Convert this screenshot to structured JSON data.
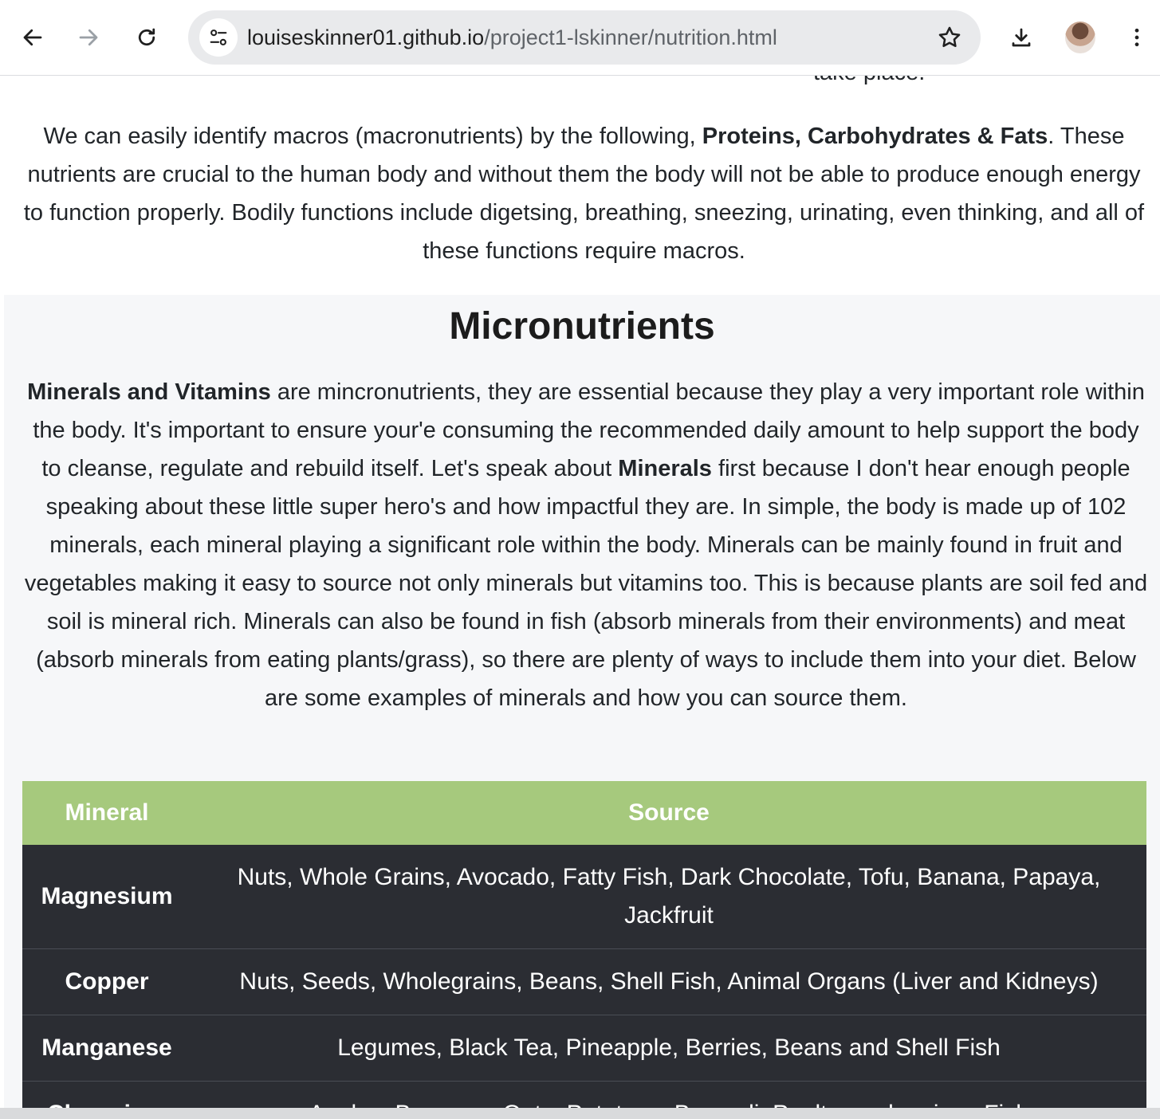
{
  "browser": {
    "url_host": "louiseskinner01.github.io",
    "url_path": "/project1-lskinner/nutrition.html"
  },
  "page": {
    "cut_off_text": "take place.",
    "macro_paragraph": {
      "before_bold": "We can easily identify macros (macronutrients) by the following, ",
      "bold": "Proteins, Carbohydrates & Fats",
      "after_bold": ". These nutrients are crucial to the human body and without them the body will not be able to produce enough energy to function properly. Bodily functions include digetsing, breathing, sneezing, urinating, even thinking, and all of these functions require macros."
    },
    "micronutrients": {
      "title": "Micronutrients",
      "bold1": "Minerals and Vitamins",
      "text1": " are mincronutrients, they are essential because they play a very important role within the body. It's important to ensure your'e consuming the recommended daily amount to help support the body to cleanse, regulate and rebuild itself. Let's speak about ",
      "bold2": "Minerals",
      "text2": " first because I don't hear enough people speaking about these little super hero's and how impactful they are. In simple, the body is made up of 102 minerals, each mineral playing a significant role within the body. Minerals can be mainly found in fruit and vegetables making it easy to source not only minerals but vitamins too. This is because plants are soil fed and soil is mineral rich. Minerals can also be found in fish (absorb minerals from their environments) and meat (absorb minerals from eating plants/grass), so there are plenty of ways to include them into your diet. Below are some examples of minerals and how you can source them."
    },
    "table": {
      "headers": [
        "Mineral",
        "Source"
      ],
      "rows": [
        {
          "mineral": "Magnesium",
          "source": "Nuts, Whole Grains, Avocado, Fatty Fish, Dark Chocolate, Tofu, Banana, Papaya, Jackfruit"
        },
        {
          "mineral": "Copper",
          "source": "Nuts, Seeds, Wholegrains, Beans, Shell Fish, Animal Organs (Liver and Kidneys)"
        },
        {
          "mineral": "Manganese",
          "source": "Legumes, Black Tea, Pineapple, Berries, Beans and Shell Fish"
        },
        {
          "mineral": "Chromium",
          "source": "Apples, Bananas, Oats, Potatoes, Broccoli, Poultry and various Fish"
        }
      ]
    }
  }
}
